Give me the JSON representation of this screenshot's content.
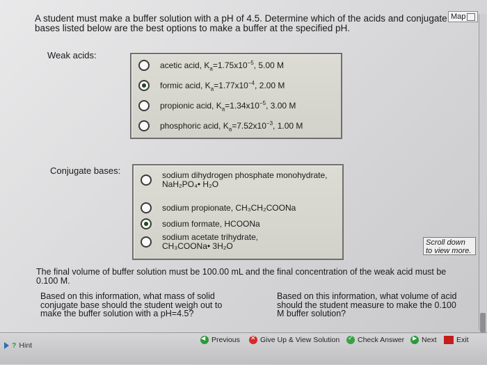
{
  "question": {
    "text": "A student must make a buffer solution with a pH of 4.5. Determine which of the acids and conjugate bases listed below are the best options to make a buffer at the specified pH."
  },
  "map_label": "Map",
  "weak_acids": {
    "label": "Weak acids:",
    "options": [
      {
        "name": "acetic acid, K",
        "ka": "=1.75x10",
        "exp": "−5",
        "conc": ", 5.00 M",
        "selected": false
      },
      {
        "name": "formic acid, K",
        "ka": "=1.77x10",
        "exp": "−4",
        "conc": ", 2.00 M",
        "selected": true
      },
      {
        "name": "propionic acid, K",
        "ka": "=1.34x10",
        "exp": "−5",
        "conc": ", 3.00 M",
        "selected": false
      },
      {
        "name": "phosphoric acid, K",
        "ka": "=7.52x10",
        "exp": "−3",
        "conc": ", 1.00 M",
        "selected": false
      }
    ],
    "ka_subscript": "a"
  },
  "conjugate_bases": {
    "label": "Conjugate bases:",
    "options": [
      {
        "line1": "sodium dihydrogen phosphate monohydrate,",
        "line2": "NaH₂PO₄• H₂O",
        "selected": false
      },
      {
        "line1": "sodium propionate, CH₃CH₂COONa",
        "line2": "",
        "selected": false
      },
      {
        "line1": "sodium formate, HCOONa",
        "line2": "",
        "selected": true
      },
      {
        "line1": "sodium acetate trihydrate,",
        "line2": "CH₃COONa• 3H₂O",
        "selected": false
      }
    ]
  },
  "scroll_note": {
    "line1": "Scroll down",
    "line2": "to view more."
  },
  "final_volume_text": "The final volume of buffer solution must be 100.00 mL and the final concentration of the weak acid must be 0.100 M.",
  "subq_mass": "Based on this information, what mass of solid conjugate base should the student weigh out to make the buffer solution with a pH=4.5?",
  "subq_volume": "Based on this information, what volume of acid should the student measure to make the 0.100 M buffer solution?",
  "toolbar": {
    "hint": "Hint",
    "previous": "Previous",
    "give_up": "Give Up & View Solution",
    "check": "Check Answer",
    "next": "Next",
    "exit": "Exit"
  }
}
